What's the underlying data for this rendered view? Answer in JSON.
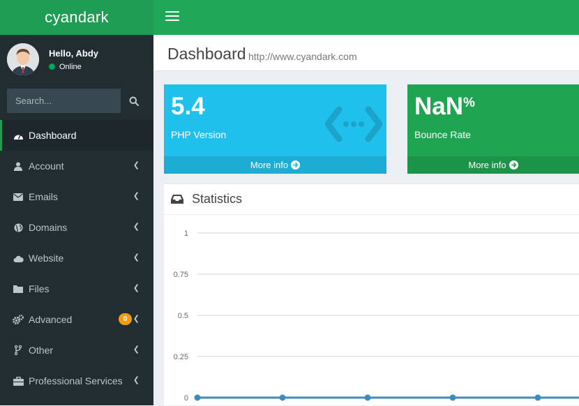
{
  "app": {
    "logo": "cyandark"
  },
  "user": {
    "greeting": "Hello, Abdy",
    "status": "Online"
  },
  "search": {
    "placeholder": "Search..."
  },
  "menu": [
    {
      "label": "Dashboard",
      "icon": "dashboard-icon",
      "active": true
    },
    {
      "label": "Account",
      "icon": "user-icon"
    },
    {
      "label": "Emails",
      "icon": "envelope-icon"
    },
    {
      "label": "Domains",
      "icon": "globe-icon"
    },
    {
      "label": "Website",
      "icon": "cloud-icon"
    },
    {
      "label": "Files",
      "icon": "folder-icon"
    },
    {
      "label": "Advanced",
      "icon": "cogs-icon",
      "badge": "0"
    },
    {
      "label": "Other",
      "icon": "code-fork-icon"
    },
    {
      "label": "Professional Services",
      "icon": "briefcase-icon"
    }
  ],
  "header": {
    "title": "Dashboard",
    "subtitle": "http://www.cyandark.com"
  },
  "boxes": [
    {
      "value": "5.4",
      "label": "PHP Version",
      "footer": "More info",
      "color": "#20c0ed",
      "icon": "code-icon"
    },
    {
      "value": "NaN",
      "suffix": "%",
      "label": "Bounce Rate",
      "footer": "More info",
      "color": "#1fa552"
    }
  ],
  "statistics": {
    "title": "Statistics"
  },
  "colors": {
    "sidebar": "#222d32",
    "brand": "#1f9d55",
    "topbar": "#21a758",
    "line": "#3c8dbc"
  },
  "chart_data": {
    "type": "line",
    "title": "",
    "x": [
      1,
      2,
      3,
      4,
      5
    ],
    "series": [
      {
        "values": [
          0,
          0,
          0,
          0,
          0
        ]
      }
    ],
    "ylim": [
      0,
      1
    ],
    "yticks": [
      "0",
      "0.25",
      "0.5",
      "0.75",
      "1"
    ],
    "grid": true
  }
}
